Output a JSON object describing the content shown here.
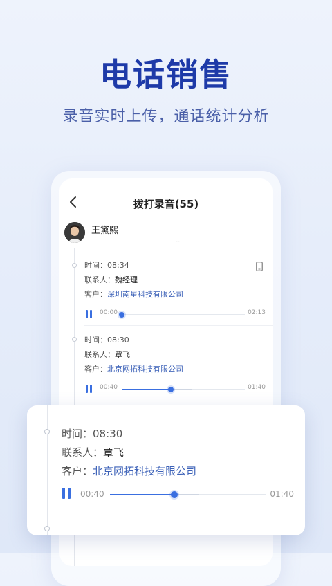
{
  "header": {
    "title": "电话销售",
    "subtitle": "录音实时上传，通话统计分析"
  },
  "screen": {
    "nav_title": "拨打录音(55)",
    "user_name": "王黛熙",
    "records": [
      {
        "time_label": "时间：",
        "time_value": "08:34",
        "contact_label": "联系人：",
        "contact_value": "魏经理",
        "client_label": "客户：",
        "client_value": "深圳南星科技有限公司",
        "start": "00:00",
        "end": "02:13",
        "progress": 0.0,
        "buffered": 0.0
      },
      {
        "time_label": "时间：",
        "time_value": "08:30",
        "contact_label": "联系人：",
        "contact_value": "覃飞",
        "client_label": "客户：",
        "client_value": "北京网拓科技有限公司",
        "start": "00:40",
        "end": "01:40",
        "progress": 0.4,
        "buffered": 0.57
      }
    ]
  },
  "card": {
    "time_label": "时间：",
    "time_value": "08:30",
    "contact_label": "联系人：",
    "contact_value": "覃飞",
    "client_label": "客户：",
    "client_value": "北京网拓科技有限公司",
    "start": "00:40",
    "end": "01:40",
    "progress": 0.41,
    "buffered": 0.57
  },
  "colors": {
    "accent": "#3a6fe0",
    "title": "#1e3aa8",
    "link": "#3d62b8"
  },
  "icons": [
    "back-arrow-icon",
    "phone-device-icon",
    "pause-icon"
  ]
}
